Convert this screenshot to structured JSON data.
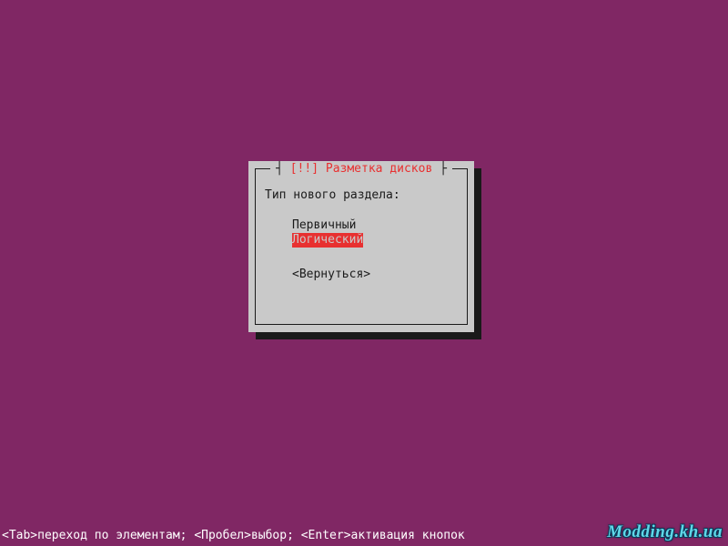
{
  "dialog": {
    "title": " [!!] Разметка дисков ",
    "prompt": "Тип нового раздела:",
    "options": {
      "primary": "Первичный",
      "logical": "Логический"
    },
    "back": "<Вернуться>"
  },
  "footer": {
    "tab": "<Tab>переход по элементам;",
    "space": "<Пробел>выбор;",
    "enter": "<Enter>активация кнопок"
  },
  "watermark": "Modding.kh.ua"
}
